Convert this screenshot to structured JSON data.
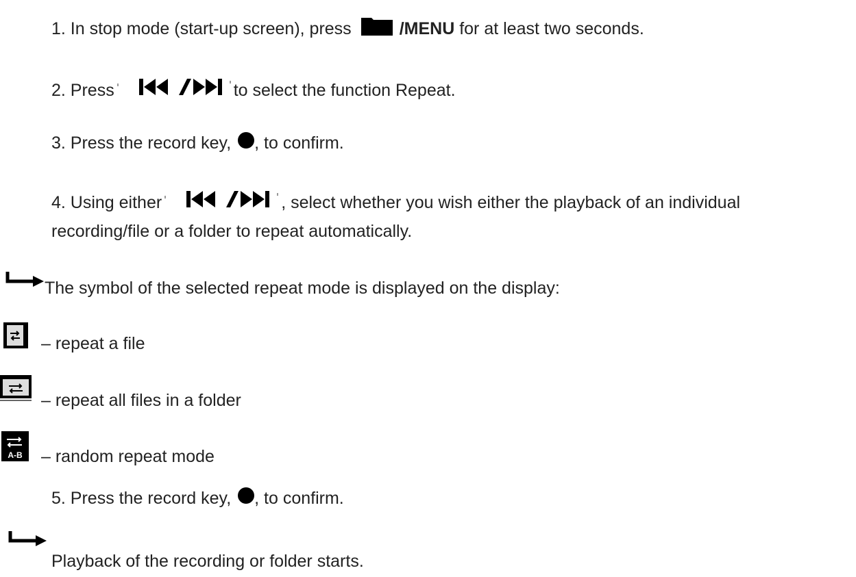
{
  "steps": {
    "step1": {
      "text_before": "1. In stop mode (start-up screen), press",
      "key_label": "/MENU",
      "text_after": "for at least two seconds.",
      "icon": "folder-icon"
    },
    "step2": {
      "text_before": "2. Press",
      "text_after": "to select the function Repeat.",
      "icon": "skip-back-forward-icon"
    },
    "step3": {
      "text_before": "3. Press the record key,",
      "text_after": ", to confirm.",
      "icon": "record-dot-icon"
    },
    "step4": {
      "text_before": "4. Using either",
      "text_after": ", select whether you wish either the playback of an individual",
      "line2": "recording/file or a folder to repeat automatically.",
      "icon": "skip-back-forward-icon"
    },
    "step5": {
      "text_before": "5. Press the record key,",
      "text_after": ", to confirm.",
      "icon": "record-dot-icon"
    }
  },
  "results": {
    "result1": "The symbol of the selected repeat mode is displayed on the display:",
    "result2": "Playback of the recording or folder starts."
  },
  "modes": [
    {
      "label": "– repeat a file",
      "icon": "repeat-file-icon"
    },
    {
      "label": "– repeat all files in a folder",
      "icon": "repeat-folder-icon"
    },
    {
      "label": "– random repeat mode",
      "icon": "random-repeat-icon",
      "icon_text": "A-B"
    }
  ]
}
